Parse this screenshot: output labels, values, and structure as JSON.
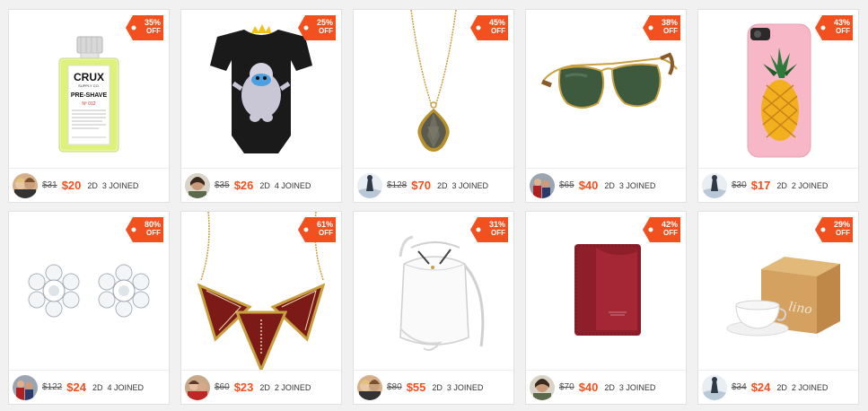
{
  "products": [
    {
      "discount": "35%",
      "off_label": "OFF",
      "old_price": "$31",
      "new_price": "$20",
      "days": "2D",
      "joined": "3 JOINED",
      "image": "crux-pre-shave-bottle"
    },
    {
      "discount": "25%",
      "off_label": "OFF",
      "old_price": "$35",
      "new_price": "$26",
      "days": "2D",
      "joined": "4 JOINED",
      "image": "yeti-baby-onesie"
    },
    {
      "discount": "45%",
      "off_label": "OFF",
      "old_price": "$128",
      "new_price": "$70",
      "days": "2D",
      "joined": "3 JOINED",
      "image": "teardrop-gem-pendant"
    },
    {
      "discount": "38%",
      "off_label": "OFF",
      "old_price": "$65",
      "new_price": "$40",
      "days": "2D",
      "joined": "3 JOINED",
      "image": "aviator-sunglasses"
    },
    {
      "discount": "43%",
      "off_label": "OFF",
      "old_price": "$30",
      "new_price": "$17",
      "days": "2D",
      "joined": "2 JOINED",
      "image": "pineapple-phone-case"
    },
    {
      "discount": "80%",
      "off_label": "OFF",
      "old_price": "$122",
      "new_price": "$24",
      "days": "2D",
      "joined": "4 JOINED",
      "image": "flower-crystal-earrings"
    },
    {
      "discount": "61%",
      "off_label": "OFF",
      "old_price": "$60",
      "new_price": "$23",
      "days": "2D",
      "joined": "2 JOINED",
      "image": "triangle-bib-necklace"
    },
    {
      "discount": "31%",
      "off_label": "OFF",
      "old_price": "$80",
      "new_price": "$55",
      "days": "2D",
      "joined": "3 JOINED",
      "image": "white-bucket-bag"
    },
    {
      "discount": "42%",
      "off_label": "OFF",
      "old_price": "$70",
      "new_price": "$40",
      "days": "2D",
      "joined": "3 JOINED",
      "image": "red-leather-wallet"
    },
    {
      "discount": "29%",
      "off_label": "OFF",
      "old_price": "$34",
      "new_price": "$24",
      "days": "2D",
      "joined": "2 JOINED",
      "image": "espresso-cup-gift-box"
    }
  ],
  "images": {
    "crux_brand": "CRUX",
    "crux_sub": "SUPPLY CO.",
    "crux_product": "PRE-SHAVE",
    "crux_number": "Nº 012",
    "lino_box_text": "lino"
  },
  "colors": {
    "accent": "#f2501e",
    "badge": "#f2501e",
    "background": "#f1f1f1"
  }
}
